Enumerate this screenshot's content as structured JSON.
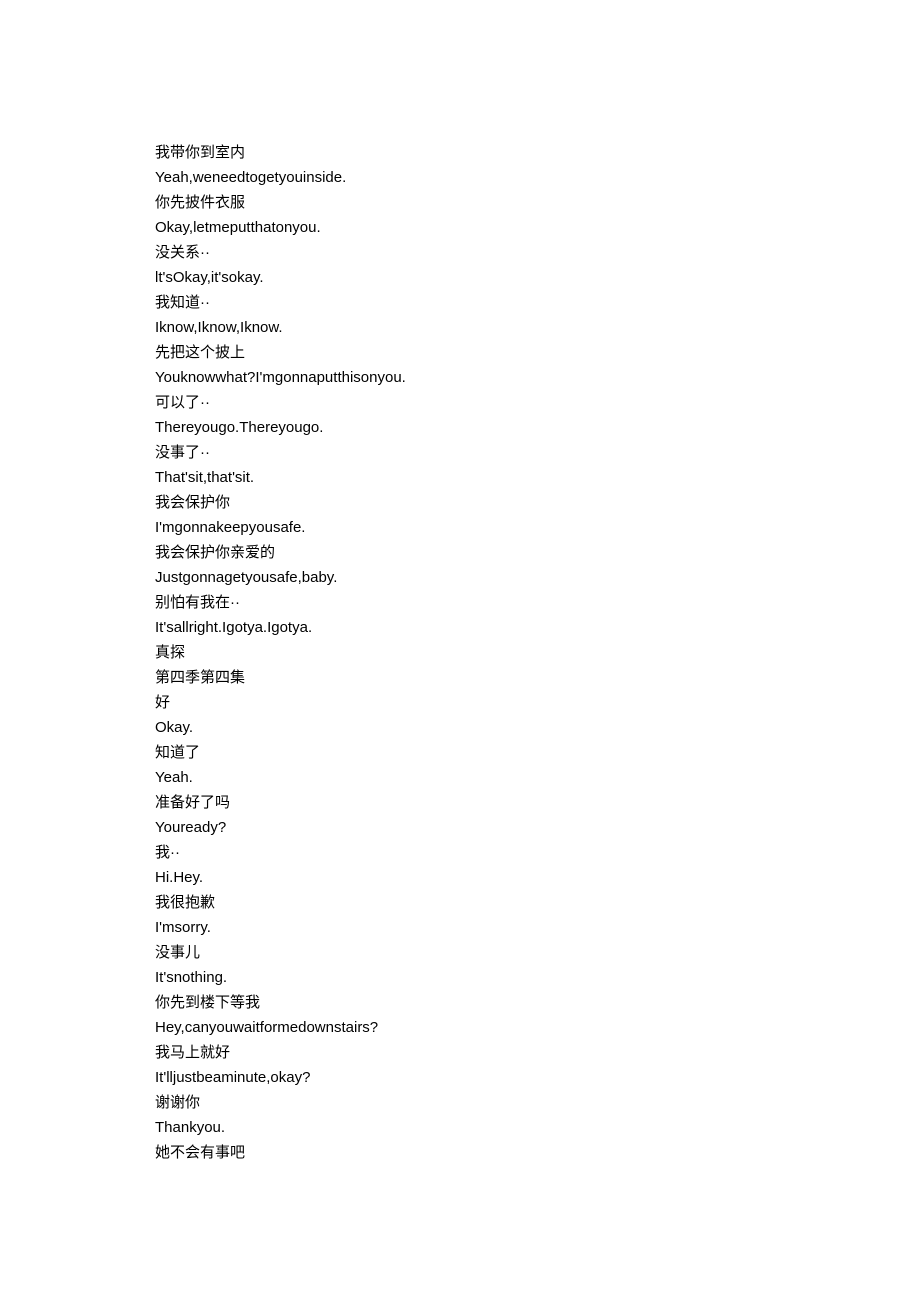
{
  "lines": [
    "我带你到室内",
    "Yeah,weneedtogetyouinside.",
    "你先披件衣服",
    "Okay,letmeputthatonyou.",
    "没关系··",
    "lt'sOkay,it'sokay.",
    "我知道··",
    "Iknow,Iknow,Iknow.",
    "先把这个披上",
    "Youknowwhat?I'mgonnaputthisonyou.",
    "可以了··",
    "Thereyougo.Thereyougo.",
    "没事了··",
    "That'sit,that'sit.",
    "我会保护你",
    "I'mgonnakeepyousafe.",
    "我会保护你亲爱的",
    "Justgonnagetyousafe,baby.",
    "别怕有我在··",
    "It'sallright.Igotya.Igotya.",
    "真探",
    "第四季第四集",
    "好",
    "Okay.",
    "知道了",
    "Yeah.",
    "准备好了吗",
    "Youready?",
    "我··",
    "Hi.Hey.",
    "我很抱歉",
    "I'msorry.",
    "没事儿",
    "It'snothing.",
    "你先到楼下等我",
    "Hey,canyouwaitformedownstairs?",
    "我马上就好",
    "It'lljustbeaminute,okay?",
    "谢谢你",
    "Thankyou.",
    "她不会有事吧"
  ]
}
